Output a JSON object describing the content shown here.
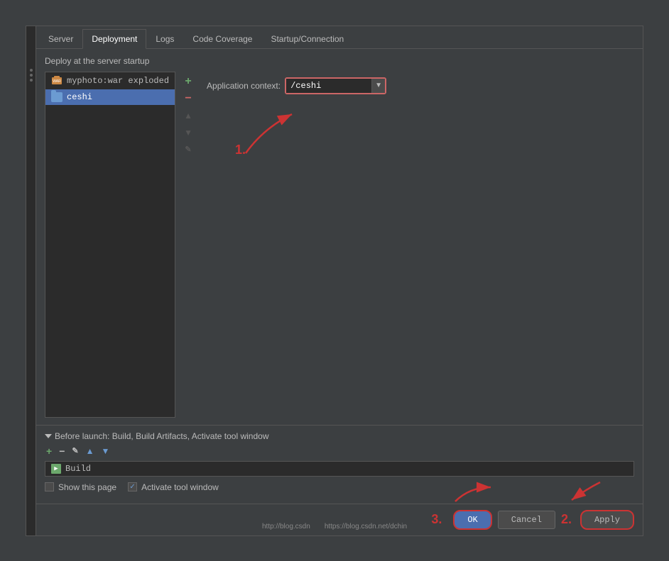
{
  "tabs": [
    {
      "label": "Server",
      "active": false
    },
    {
      "label": "Deployment",
      "active": true
    },
    {
      "label": "Logs",
      "active": false
    },
    {
      "label": "Code Coverage",
      "active": false
    },
    {
      "label": "Startup/Connection",
      "active": false
    }
  ],
  "deploy_label": "Deploy at the server startup",
  "artifacts": [
    {
      "name": "myphoto:war exploded",
      "type": "war",
      "selected": false
    },
    {
      "name": "ceshi",
      "type": "folder",
      "selected": true
    }
  ],
  "context": {
    "label": "Application context:",
    "value": "/ceshi"
  },
  "annotation_1": "1.",
  "before_launch": {
    "header": "Before launch: Build, Build Artifacts, Activate tool window",
    "build_items": [
      {
        "label": "Build"
      }
    ]
  },
  "checkboxes": [
    {
      "label": "Show this page",
      "checked": false
    },
    {
      "label": "Activate tool window",
      "checked": true
    }
  ],
  "annotation_2": "2.",
  "annotation_3": "3.",
  "buttons": {
    "ok": "OK",
    "cancel": "Cancel",
    "apply": "Apply"
  },
  "watermark_left": "http://blog.csdn",
  "watermark_right": "https://blog.csdn.net/dchin"
}
